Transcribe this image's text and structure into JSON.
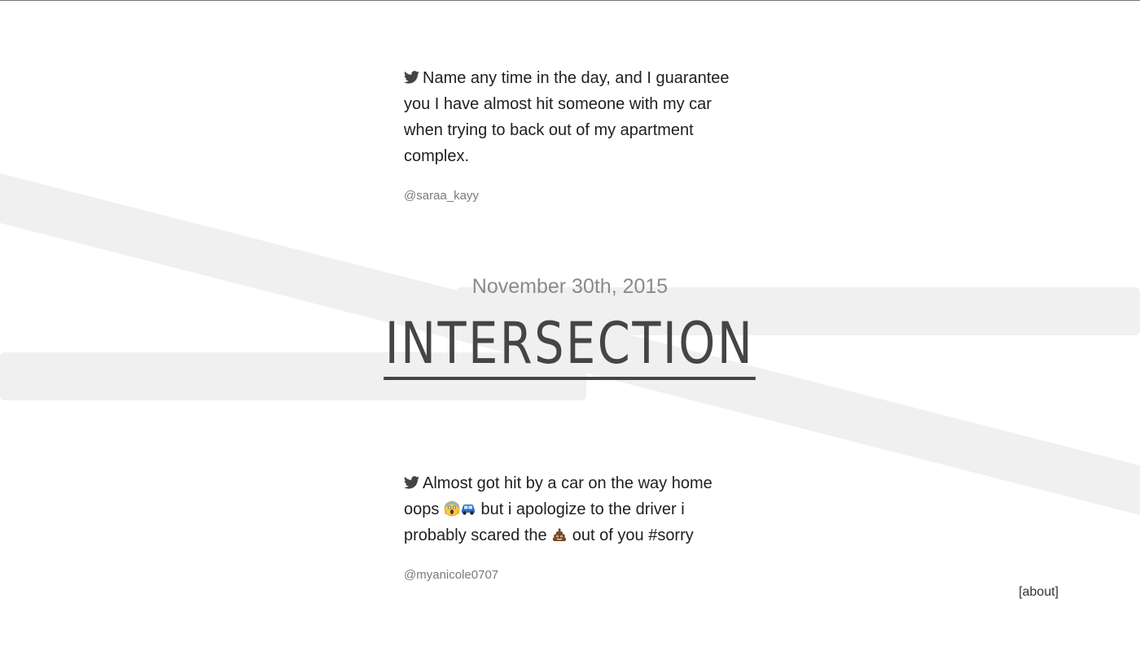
{
  "tweets": [
    {
      "icon": "twitter-bird-icon",
      "text": "Name any time in the day, and I guarantee you I have almost hit someone with my car when trying to back out of my apartment complex.",
      "handle": "@saraa_kayy"
    },
    {
      "icon": "twitter-bird-icon",
      "text_before_emoji": "Almost got hit by a car on the way home oops ",
      "emojis_1": [
        "screaming-face-emoji",
        "car-emoji"
      ],
      "text_middle": " but i apologize to the driver i probably scared the ",
      "emojis_2": [
        "pile-of-poo-emoji"
      ],
      "text_after_emoji": " out of you #sorry",
      "handle": "@myanicole0707"
    }
  ],
  "header": {
    "date": "November 30th, 2015",
    "title": "INTERSECTION"
  },
  "footer": {
    "about_label": "[about]"
  },
  "colors": {
    "stripe": "#f0f0f0",
    "title": "#454545",
    "date": "#8a8a8a",
    "handle": "#7a7a7a"
  }
}
